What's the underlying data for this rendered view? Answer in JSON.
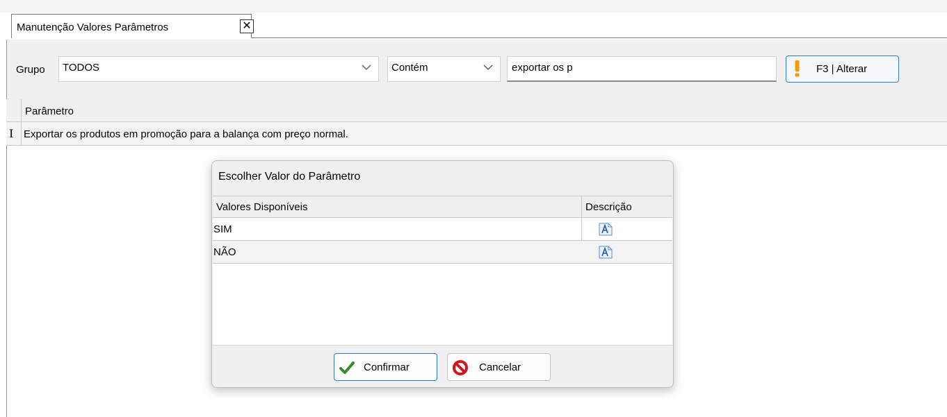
{
  "tab": {
    "title": "Manutenção Valores Parâmetros",
    "close_label": "✕"
  },
  "filter": {
    "grupo_label": "Grupo",
    "grupo_value": "TODOS",
    "match_value": "Contém",
    "search_value": "exportar os p",
    "alterar_label": "F3 | Alterar"
  },
  "grid": {
    "header": "Parâmetro",
    "rows": [
      {
        "text": "Exportar os produtos em promoção para a balança com preço normal."
      }
    ],
    "row_cursor": "I"
  },
  "dialog": {
    "title": "Escolher Valor do Parâmetro",
    "columns": [
      "Valores Disponíveis",
      "Descrição"
    ],
    "rows": [
      {
        "value": "SIM"
      },
      {
        "value": "NÃO"
      }
    ],
    "confirm_label": "Confirmar",
    "cancel_label": "Cancelar"
  },
  "colors": {
    "accent": "#2b78c5",
    "warning": "#f59b00",
    "confirm_check": "#2e8b2e",
    "cancel_red": "#d4141c"
  }
}
